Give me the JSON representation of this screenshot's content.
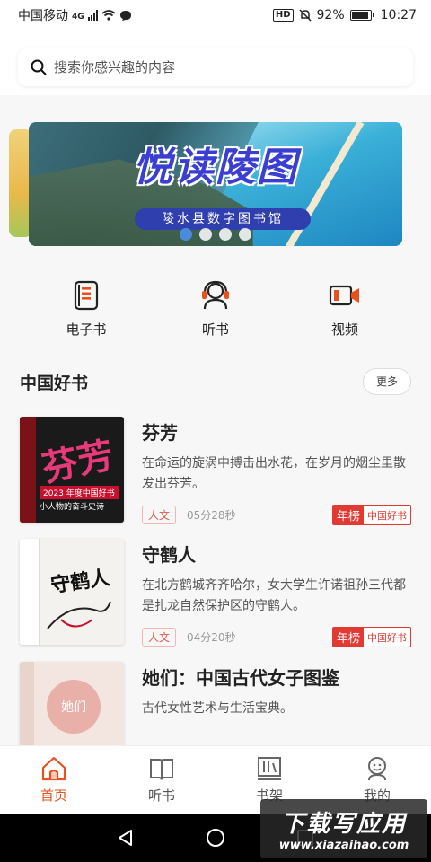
{
  "status": {
    "carrier": "中国移动",
    "network": "4G",
    "battery": "92%",
    "time": "10:27",
    "hd": "HD"
  },
  "search": {
    "placeholder": "搜索你感兴趣的内容"
  },
  "banner": {
    "title": "悦读陵图",
    "subtitle": "陵水县数字图书馆",
    "slide_count": 4,
    "active_index": 0
  },
  "quick_links": [
    {
      "label": "电子书",
      "icon": "ebook-icon"
    },
    {
      "label": "听书",
      "icon": "headphone-icon"
    },
    {
      "label": "视频",
      "icon": "video-icon"
    }
  ],
  "section": {
    "title": "中国好书",
    "more": "更多"
  },
  "books": [
    {
      "title": "芬芳",
      "desc": "在命运的旋涡中搏击出水花，在岁月的烟尘里散发出芬芳。",
      "tag": "人文",
      "duration": "05分28秒",
      "rank_a": "年榜",
      "rank_b": "中国好书"
    },
    {
      "title": "守鹤人",
      "desc": "在北方鹤城齐齐哈尔，女大学生许诺祖孙三代都是扎龙自然保护区的守鹤人。",
      "tag": "人文",
      "duration": "04分20秒",
      "rank_a": "年榜",
      "rank_b": "中国好书"
    },
    {
      "title": "她们：中国古代女子图鉴",
      "desc": "古代女性艺术与生活宝典。",
      "tag": "",
      "duration": "",
      "rank_a": "",
      "rank_b": ""
    }
  ],
  "cover_text": {
    "book1_title": "芬芳",
    "book1_banner": "2023 年度中国好书",
    "book1_sub": "小人物的奋斗史诗",
    "book2_title": "守鹤人",
    "book3_title": "她们"
  },
  "tabs": [
    {
      "label": "首页",
      "icon": "home-icon",
      "active": true
    },
    {
      "label": "听书",
      "icon": "book-open-icon",
      "active": false
    },
    {
      "label": "书架",
      "icon": "bookshelf-icon",
      "active": false
    },
    {
      "label": "我的",
      "icon": "profile-icon",
      "active": false
    }
  ],
  "watermark": {
    "line1": "下载写应用",
    "line2": "www.xiazaihao.com"
  },
  "colors": {
    "accent": "#e8501d",
    "rank_red": "#e03a33",
    "tag_red": "#e05a4e"
  }
}
